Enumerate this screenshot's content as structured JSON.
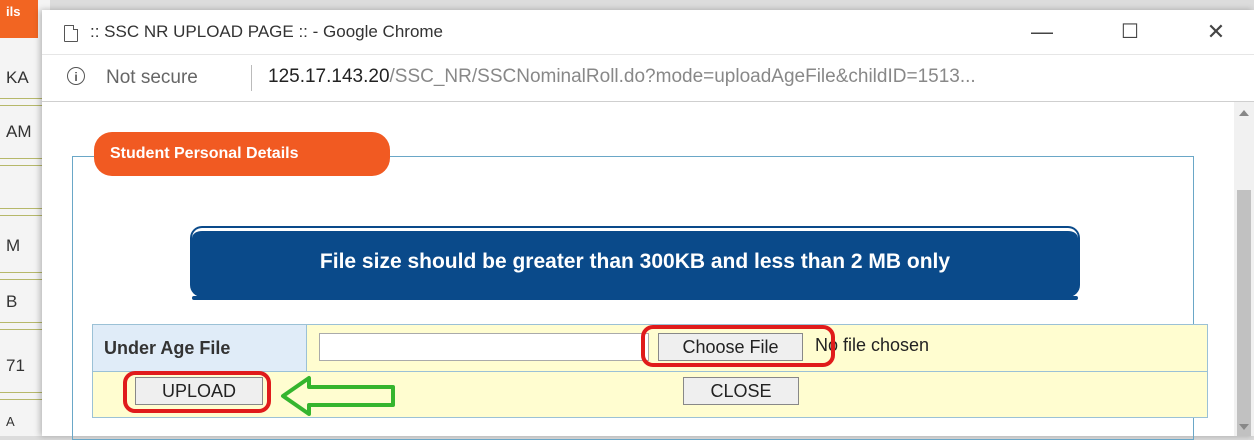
{
  "background_page": {
    "tab_label": "ils",
    "cells": [
      "KA",
      "AM",
      "M",
      "B",
      "71",
      "A"
    ]
  },
  "window": {
    "title": ":: SSC NR UPLOAD PAGE :: - Google Chrome",
    "minimize": "—",
    "maximize": "☐",
    "close": "✕"
  },
  "address_bar": {
    "security_label": "Not secure",
    "url_host": "125.17.143.20",
    "url_path": "/SSC_NR/SSCNominalRoll.do?mode=uploadAgeFile&childID=1513..."
  },
  "section": {
    "legend": "Student Personal Details"
  },
  "notice": {
    "text": "File size should be greater than 300KB and less than 2 MB only"
  },
  "form": {
    "field_label": "Under Age File",
    "choose_file": "Choose File",
    "no_file": "No file chosen",
    "upload": "UPLOAD",
    "close": "CLOSE"
  },
  "colors": {
    "accent_orange": "#f15a22",
    "banner_blue": "#0a4a8a",
    "highlight_red": "#e01b1b",
    "arrow_green": "#35b52e",
    "form_bg": "#fffdd0"
  }
}
